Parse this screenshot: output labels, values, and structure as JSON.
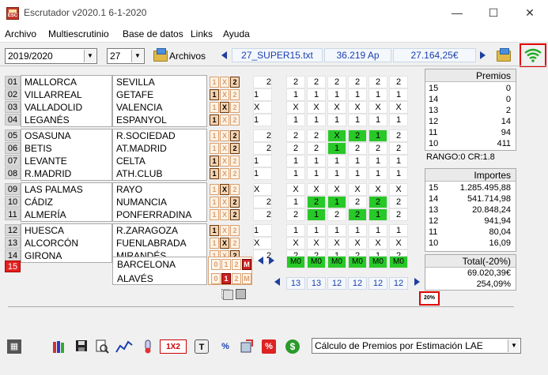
{
  "window": {
    "title": "Escrutador v2020.1 6-1-2020",
    "minimize": "—",
    "maximize": "☐",
    "close": "✕"
  },
  "menu": [
    "Archivo",
    "Multiescrutinio",
    "Base de datos",
    "Links",
    "Ayuda"
  ],
  "toolbar": {
    "season": "2019/2020",
    "jornada": "27",
    "archivos_label": "Archivos",
    "file_name": "27_SUPER15.txt",
    "apuestas": "36.219 Ap",
    "importe": "27.164,25€"
  },
  "matches": [
    {
      "n": "01",
      "home": "MALLORCA",
      "away": "SEVILLA",
      "sign": "2"
    },
    {
      "n": "02",
      "home": "VILLARREAL",
      "away": "GETAFE",
      "sign": "1"
    },
    {
      "n": "03",
      "home": "VALLADOLID",
      "away": "VALENCIA",
      "sign": "X"
    },
    {
      "n": "04",
      "home": "LEGANÉS",
      "away": "ESPANYOL",
      "sign": "1"
    },
    {
      "n": "05",
      "home": "OSASUNA",
      "away": "R.SOCIEDAD",
      "sign": "2"
    },
    {
      "n": "06",
      "home": "BETIS",
      "away": "AT.MADRID",
      "sign": "2"
    },
    {
      "n": "07",
      "home": "LEVANTE",
      "away": "CELTA",
      "sign": "1"
    },
    {
      "n": "08",
      "home": "R.MADRID",
      "away": "ATH.CLUB",
      "sign": "1"
    },
    {
      "n": "09",
      "home": "LAS PALMAS",
      "away": "RAYO",
      "sign": "X"
    },
    {
      "n": "10",
      "home": "CÁDIZ",
      "away": "NUMANCIA",
      "sign": "2"
    },
    {
      "n": "11",
      "home": "ALMERÍA",
      "away": "PONFERRADINA",
      "sign": "2"
    },
    {
      "n": "12",
      "home": "HUESCA",
      "away": "R.ZARAGOZA",
      "sign": "1"
    },
    {
      "n": "13",
      "home": "ALCORCÓN",
      "away": "FUENLABRADA",
      "sign": "X"
    },
    {
      "n": "14",
      "home": "GIRONA",
      "away": "MIRANDÉS",
      "sign": "2"
    }
  ],
  "pleno": {
    "n": "15",
    "home": "BARCELONA",
    "away": "ALAVÉS",
    "home_sign": "M",
    "away_sign": "1"
  },
  "sign_labels": [
    "1",
    "X",
    "2"
  ],
  "pleno_labels": [
    "0",
    "1",
    "2",
    "M"
  ],
  "columns": [
    [
      "2",
      "1",
      "X",
      "1",
      "2",
      "2",
      "1",
      "1",
      "X",
      "2",
      "2",
      "1",
      "X",
      "2"
    ],
    [
      "2",
      "1",
      "X",
      "1",
      "2",
      "2",
      "1",
      "1",
      "X",
      "1",
      "2",
      "1",
      "X",
      "2"
    ],
    [
      "2",
      "1",
      "X",
      "1",
      "2",
      "2",
      "1",
      "1",
      "X",
      "2",
      "1",
      "1",
      "X",
      "2"
    ],
    [
      "2",
      "1",
      "X",
      "1",
      "X",
      "1",
      "1",
      "1",
      "X",
      "1",
      "2",
      "1",
      "X",
      "1"
    ],
    [
      "2",
      "1",
      "X",
      "1",
      "2",
      "2",
      "1",
      "1",
      "X",
      "2",
      "2",
      "1",
      "X",
      "2"
    ],
    [
      "2",
      "1",
      "X",
      "1",
      "1",
      "2",
      "1",
      "1",
      "X",
      "2",
      "1",
      "1",
      "X",
      "1"
    ],
    [
      "2",
      "1",
      "X",
      "1",
      "2",
      "2",
      "1",
      "1",
      "X",
      "2",
      "2",
      "1",
      "X",
      "2"
    ]
  ],
  "single_column": [
    "2",
    "1",
    "X",
    "1",
    "2",
    "2",
    "1",
    "1",
    "X",
    "2",
    "2",
    "1",
    "X",
    "2"
  ],
  "pleno_cols": [
    "M0",
    "M0",
    "M0",
    "M0",
    "M0",
    "M0"
  ],
  "hits": [
    "13",
    "13",
    "12",
    "12",
    "12",
    "12"
  ],
  "premios": {
    "title": "Premios",
    "rows": [
      {
        "k": "15",
        "v": "0"
      },
      {
        "k": "14",
        "v": "0"
      },
      {
        "k": "13",
        "v": "2"
      },
      {
        "k": "12",
        "v": "14"
      },
      {
        "k": "11",
        "v": "94"
      },
      {
        "k": "10",
        "v": "411"
      }
    ]
  },
  "rango": "RANGO:0 CR:1.8",
  "importes": {
    "title": "Importes",
    "rows": [
      {
        "k": "15",
        "v": "1.285.495,88"
      },
      {
        "k": "14",
        "v": "541.714,98"
      },
      {
        "k": "13",
        "v": "20.848,24"
      },
      {
        "k": "12",
        "v": "941,94"
      },
      {
        "k": "11",
        "v": "80,04"
      },
      {
        "k": "10",
        "v": "16,09"
      }
    ]
  },
  "total": {
    "title": "Total(-20%)",
    "amount": "69.020,39€",
    "percent": "254,09%"
  },
  "pct_button": "20%",
  "bottom_select": "Cálculo de Premios por Estimación LAE",
  "colors": {
    "accent": "#1a3fb0",
    "green": "#28c828",
    "red": "#e42020",
    "wifi": "#22aa22"
  }
}
